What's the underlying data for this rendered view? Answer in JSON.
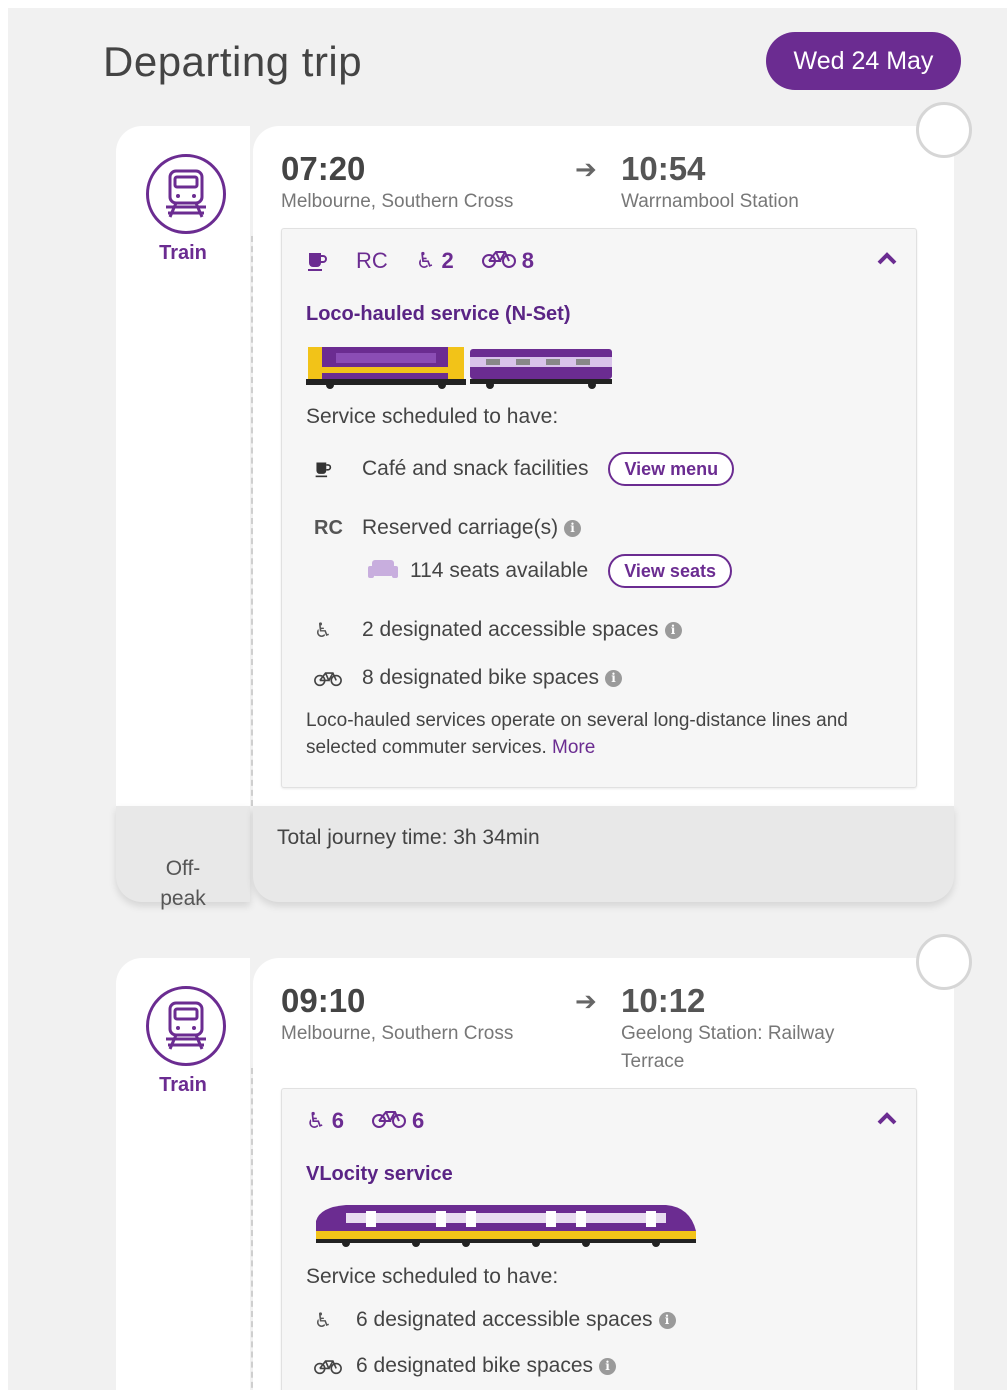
{
  "header": {
    "title": "Departing trip",
    "date": "Wed 24 May"
  },
  "trips": [
    {
      "mode_label": "Train",
      "depart_time": "07:20",
      "depart_station": "Melbourne, Southern Cross",
      "arrive_time": "10:54",
      "arrive_station": "Warrnambool Station",
      "features": {
        "rc": "RC",
        "accessible_count": "2",
        "bike_count": "8"
      },
      "service_name": "Loco-hauled service (N-Set)",
      "scheduled_label": "Service scheduled to have:",
      "cafe_text": "Café and snack facilities",
      "view_menu": "View menu",
      "rc_code": "RC",
      "reserved_text": "Reserved carriage(s)",
      "seats_text": "114 seats available",
      "view_seats": "View seats",
      "accessible_text": "2 designated accessible spaces",
      "bike_text": "8 designated bike spaces",
      "description": "Loco-hauled services operate on several long-distance lines and selected commuter services.",
      "more_link": "More",
      "fare_type": "Off-\npeak",
      "journey_time": "Total journey time: 3h 34min"
    },
    {
      "mode_label": "Train",
      "depart_time": "09:10",
      "depart_station": "Melbourne, Southern Cross",
      "arrive_time": "10:12",
      "arrive_station": "Geelong Station: Railway Terrace",
      "features": {
        "accessible_count": "6",
        "bike_count": "6"
      },
      "service_name": "VLocity service",
      "scheduled_label": "Service scheduled to have:",
      "accessible_text": "6 designated accessible spaces",
      "bike_text": "6 designated bike spaces"
    }
  ],
  "icons": {
    "mode": "train-icon",
    "cafe": "coffee-cup-icon",
    "accessible": "wheelchair-icon",
    "bike": "bicycle-icon",
    "seat": "seat-icon",
    "info": "info-icon",
    "collapse": "chevron-up-icon",
    "arrow": "arrow-right-icon"
  },
  "colors": {
    "brand_purple": "#6b2c91",
    "train_yellow": "#f2c318"
  }
}
